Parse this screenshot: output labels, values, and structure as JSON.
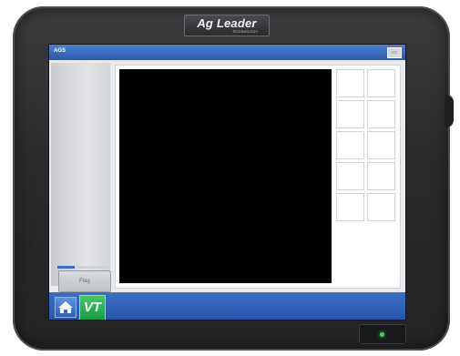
{
  "device": {
    "brand": "Ag Leader",
    "brand_sub": "TECHNOLOGY"
  },
  "screen": {
    "top_bar_title": "AGS",
    "left_panel_button": "Flag",
    "left_progress_fraction": 0.35,
    "widget_slot_count": 10,
    "bottom_bar": {
      "home_icon": "home-icon",
      "vt_label": "VT"
    }
  },
  "colors": {
    "bar_blue": "#2a58ad",
    "vt_green": "#169c43",
    "led_green": "#32d85a",
    "map_background": "#000000"
  }
}
